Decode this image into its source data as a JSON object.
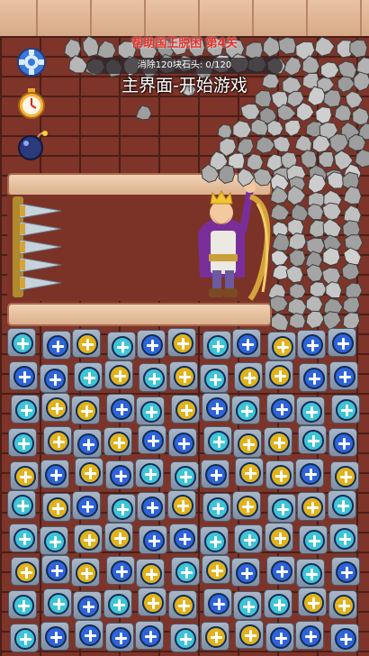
{
  "game": {
    "level_title": "帮助国王脱困 第4关",
    "progress": {
      "text": "消除120块石头: 0/120",
      "current": 0,
      "total": 120
    },
    "overlay_text": "主界面-开始游戏"
  },
  "side_buttons": [
    {
      "name": "settings-gear-button",
      "icon": "gear-icon"
    },
    {
      "name": "timer-button",
      "icon": "stopwatch-icon"
    },
    {
      "name": "bomb-button",
      "icon": "bomb-icon"
    }
  ],
  "colors": {
    "title": "#e0302a",
    "brick": "#7e3428",
    "screw_blue": "#2f63d8",
    "screw_cyan": "#3fc3d6",
    "screw_gold": "#e0b21c"
  },
  "screw_board": {
    "rows": [
      [
        "cyan",
        "blue",
        "gold",
        "cyan",
        "blue",
        "gold",
        "cyan",
        "blue",
        "gold",
        "blue",
        "blue"
      ],
      [
        "blue",
        "blue",
        "cyan",
        "gold",
        "cyan",
        "gold",
        "cyan",
        "gold",
        "gold",
        "blue",
        "blue"
      ],
      [
        "cyan",
        "gold",
        "gold",
        "blue",
        "cyan",
        "gold",
        "blue",
        "cyan",
        "blue",
        "cyan",
        "cyan"
      ],
      [
        "cyan",
        "gold",
        "blue",
        "gold",
        "blue",
        "blue",
        "cyan",
        "gold",
        "gold",
        "cyan",
        "blue"
      ],
      [
        "gold",
        "blue",
        "gold",
        "blue",
        "cyan",
        "cyan",
        "blue",
        "gold",
        "gold",
        "blue",
        "gold"
      ],
      [
        "cyan",
        "gold",
        "blue",
        "cyan",
        "blue",
        "gold",
        "cyan",
        "gold",
        "cyan",
        "gold",
        "cyan"
      ],
      [
        "cyan",
        "cyan",
        "gold",
        "gold",
        "blue",
        "blue",
        "cyan",
        "cyan",
        "gold",
        "cyan",
        "cyan"
      ],
      [
        "gold",
        "blue",
        "gold",
        "blue",
        "gold",
        "cyan",
        "gold",
        "blue",
        "blue",
        "cyan",
        "blue"
      ],
      [
        "cyan",
        "cyan",
        "blue",
        "cyan",
        "gold",
        "gold",
        "blue",
        "cyan",
        "cyan",
        "gold",
        "gold"
      ],
      [
        "cyan",
        "blue",
        "blue",
        "blue",
        "blue",
        "cyan",
        "gold",
        "gold",
        "blue",
        "blue",
        "blue"
      ]
    ]
  }
}
